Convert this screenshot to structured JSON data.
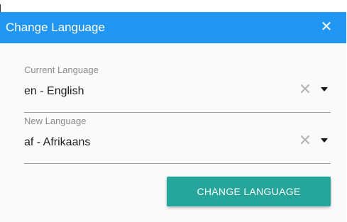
{
  "dialog": {
    "title": "Change Language",
    "close_icon": "close-icon",
    "current_language": {
      "label": "Current Language",
      "value": "en - English",
      "clear_icon": "close-icon",
      "dropdown_icon": "chevron-down-icon"
    },
    "new_language": {
      "label": "New Language",
      "value": "af - Afrikaans",
      "clear_icon": "close-icon",
      "dropdown_icon": "chevron-down-icon"
    },
    "change_button_label": "CHANGE LANGUAGE"
  },
  "colors": {
    "header": "#2196f3",
    "body": "#fafafa",
    "button": "#26a69a",
    "label": "#8a8a8a",
    "text": "#222222",
    "clear_icon": "#b5b5b5"
  }
}
